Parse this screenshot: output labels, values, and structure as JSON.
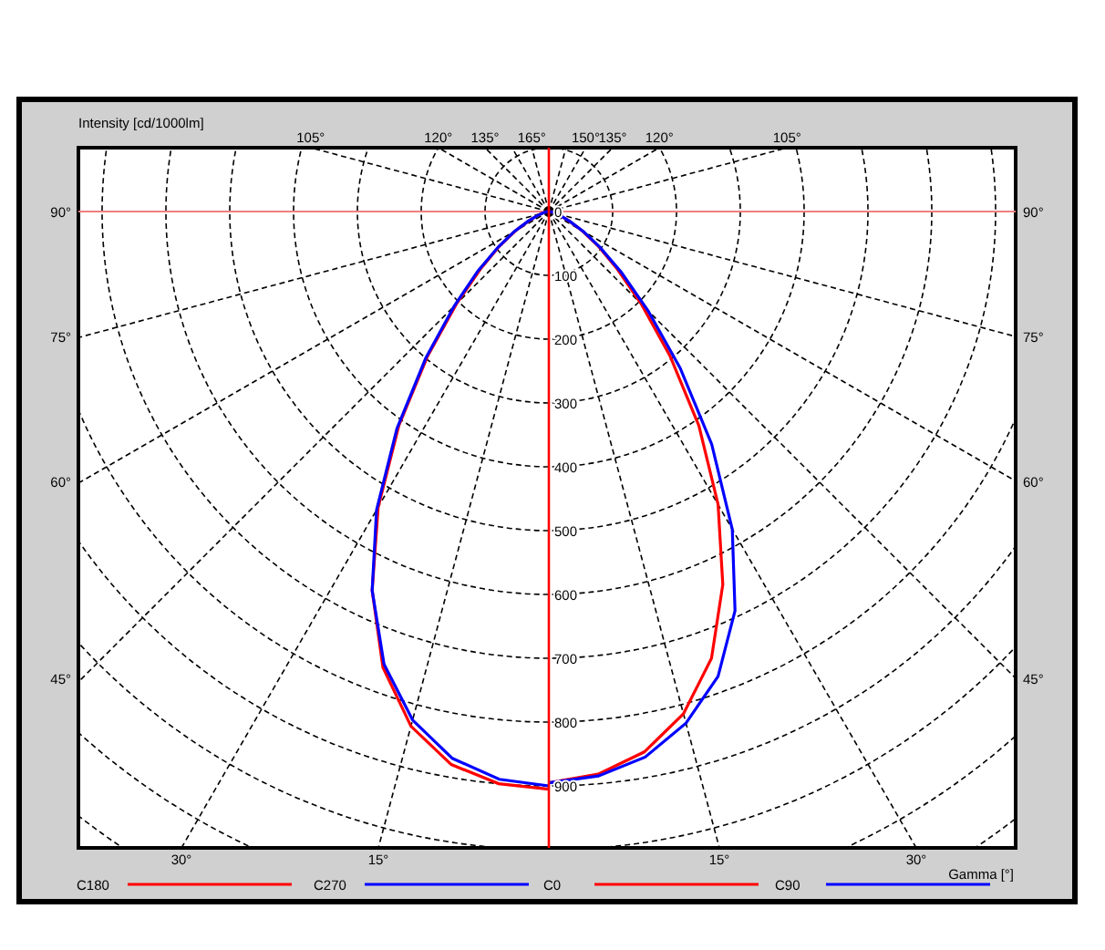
{
  "polar_diagram": {
    "axis_title": "Intensity [cd/1000lm]",
    "gamma_label": "Gamma [°]",
    "top_labels": [
      "105°",
      "120°",
      "135°",
      "165°",
      "150°",
      "135°",
      "120°",
      "105°"
    ],
    "left_labels": [
      "90°",
      "75°",
      "60°",
      "45°"
    ],
    "right_labels": [
      "90°",
      "75°",
      "60°",
      "45°"
    ],
    "bottom_labels": [
      "30°",
      "15°",
      "15°",
      "30°"
    ],
    "ring_labels": [
      "0",
      "100",
      "200",
      "300",
      "400",
      "500",
      "600",
      "700",
      "800",
      "900"
    ],
    "legend": [
      {
        "name": "C180",
        "color": "#ff0000"
      },
      {
        "name": "C270",
        "color": "#0000ff"
      },
      {
        "name": "C0",
        "color": "#ff0000"
      },
      {
        "name": "C90",
        "color": "#0000ff"
      }
    ]
  }
}
